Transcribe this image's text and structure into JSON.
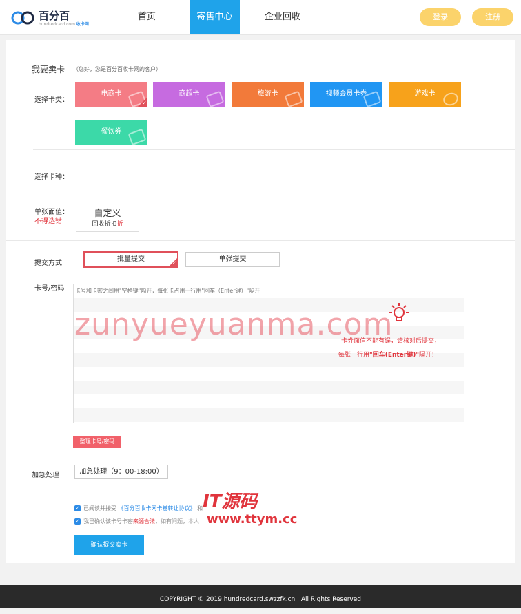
{
  "header": {
    "logo_text": "百分百",
    "logo_sub_prefix": "hundredcard.com",
    "logo_sub_brand": "收卡网",
    "nav": [
      "首页",
      "寄售中心",
      "企业回收"
    ],
    "login": "登录",
    "register": "注册",
    "accent": "#1fa3ea",
    "pill_color": "#fbd36b"
  },
  "sell": {
    "title": "我要卖卡",
    "subtitle": "（您好，您是百分百收卡网的客户）",
    "category_label": "选择卡类：",
    "categories": [
      {
        "label": "电商卡",
        "color": "#f47c85"
      },
      {
        "label": "商超卡",
        "color": "#c66be0"
      },
      {
        "label": "旅游卡",
        "color": "#f27a3a"
      },
      {
        "label": "视频会员卡券",
        "color": "#2196f3"
      },
      {
        "label": "游戏卡",
        "color": "#f7a21b"
      },
      {
        "label": "餐饮券",
        "color": "#3cd9a8"
      }
    ],
    "type_label": "选择卡种：",
    "value_label": "单张面值：",
    "value_warning": "不得选错",
    "custom_title": "自定义",
    "custom_sub": "回收折扣",
    "custom_sub_red": "折"
  },
  "submit": {
    "method_label": "提交方式",
    "batch": "批量提交",
    "single": "单张提交",
    "card_label": "卡号/密码",
    "placeholder": "卡号和卡密之间用\"空格键\"隔开，每张卡占用一行用\"回车（Enter键）\"隔开",
    "tip1": "卡券面值不能有误，请核对后提交，",
    "tip2_a": "每张一行用",
    "tip2_b": "\"回车(Enter键)\"",
    "tip2_c": "隔开！",
    "tidy_button": "整理卡号/密码",
    "urgent_label": "加急处理",
    "urgent_button": "加急处理（9：00-18:00）",
    "agree1_a": "已阅读并接受",
    "agree1_link": "《百分百收卡网卡卷转让协议》",
    "agree1_b": "和",
    "agree2_a": "我已确认该卡号卡密",
    "agree2_red": "来源合法",
    "agree2_b": "，如有问题，本人",
    "confirm": "确认提交卖卡"
  },
  "watermarks": {
    "main": "zunyueyuanma.com",
    "brand": "IT源码",
    "url": "www.ttym.cc"
  },
  "footer": {
    "copyright": "COPYRIGHT © 2019 hundredcard.swzzfk.cn . All Rights Reserved"
  }
}
